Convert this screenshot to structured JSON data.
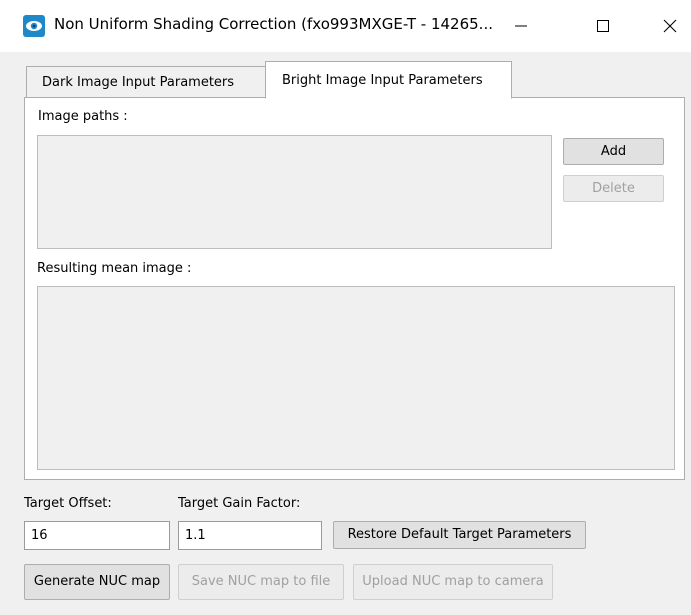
{
  "window": {
    "title": "Non Uniform Shading Correction (fxo993MXGE-T - 14265...",
    "icon": "app-eye-icon",
    "controls": {
      "minimize": "minimize-icon",
      "maximize": "maximize-icon",
      "close": "close-icon"
    }
  },
  "tabs": [
    {
      "label": "Dark Image Input Parameters",
      "selected": false
    },
    {
      "label": "Bright Image Input Parameters",
      "selected": true
    }
  ],
  "panel": {
    "image_paths_label": "Image paths :",
    "add_label": "Add",
    "delete_label": "Delete",
    "mean_image_label": "Resulting  mean image :"
  },
  "targets": {
    "offset_label": "Target Offset:",
    "offset_value": "16",
    "gain_label": "Target Gain Factor:",
    "gain_value": "1.1",
    "restore_label": "Restore Default Target Parameters"
  },
  "actions": {
    "generate_label": "Generate NUC map",
    "save_label": "Save NUC map to file",
    "upload_label": "Upload NUC map to camera"
  },
  "colors": {
    "background": "#f0f0f0",
    "panel": "#ffffff",
    "disabled_text": "#a0a0a0",
    "icon_blue": "#1e88c9"
  }
}
